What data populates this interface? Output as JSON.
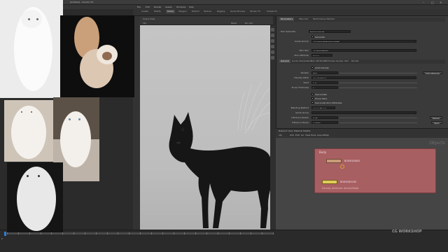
{
  "window": {
    "title": "[Untitled] - Houdini FX",
    "controls": [
      "–",
      "□",
      "✕"
    ]
  },
  "menu": {
    "items": [
      "File",
      "Edit",
      "Render",
      "Assets",
      "Windows",
      "Help"
    ]
  },
  "shelf": {
    "tabs": [
      "Create",
      "Modify",
      "Model",
      "Polygon",
      "Deform",
      "Texture",
      "Rigging",
      "Guide Process",
      "Terrain FX",
      "Simple FX"
    ]
  },
  "viewport": {
    "tab": "Scene View",
    "path": "obj",
    "camera": "Persp",
    "display": "No cam"
  },
  "params": {
    "tabs": [
      "Parameters",
      "Take List",
      "Performance Monitor"
    ],
    "node_type": "Hair Generate",
    "node_name": "BODYGROOM",
    "generate": "Generate",
    "rows": [
      {
        "label": "Guide Groom",
        "value": "obj/GROOM/BODYGUIDES"
      },
      {
        "label": "Skin Geo",
        "value": "obj/SKIN/BODY"
      },
      {
        "label": "Skin Attribute",
        "value": "Group"
      },
      {
        "label": "Density",
        "value": "800"
      },
      {
        "label": "Density Attrib",
        "value": "densityMask"
      },
      {
        "label": "Seed",
        "value": "1.3"
      },
      {
        "label": "Prune Thickness",
        "value": "1"
      },
      {
        "label": "Blending Method",
        "value": "Linear Blend"
      },
      {
        "label": "Guide Group",
        "value": ""
      },
      {
        "label": "Influence Radius",
        "value": "0.05"
      },
      {
        "label": "Influence Decay",
        "value": "2.0000"
      }
    ],
    "section_tabs": [
      "General",
      "Guide Interpolation",
      "Hair Attributes",
      "Thickness",
      "Guides",
      "Skin",
      "Render"
    ],
    "checks": [
      "Limit Density",
      "Use Guides",
      "Prune Hairs",
      "Use Guide Skin Attributes"
    ],
    "buttons": {
      "edit": "Edit Attribute",
      "reload": "Reload",
      "open": "Open"
    }
  },
  "network": {
    "tabs": [
      "Network View",
      "Material Palette"
    ],
    "path": "obj",
    "menu": [
      "Add",
      "Edit",
      "Go",
      "View",
      "Tools",
      "Layout",
      "Help"
    ],
    "context_label": "Objects",
    "subnet_title": "Body",
    "nodes": [
      {
        "label": "BODYGUIDES"
      },
      {
        "label": "BODYGROOM"
      }
    ],
    "footer": "Density Attribute: densityMask"
  },
  "timeline": {
    "frame": "1",
    "start": "1",
    "end": "240"
  },
  "watermark": "CG WORKSHOP",
  "colors": {
    "accent": "#2f7fd6",
    "subnet": "#a85f62",
    "node_guides": "#c89b7a",
    "node_groom": "#e2cb5a"
  }
}
